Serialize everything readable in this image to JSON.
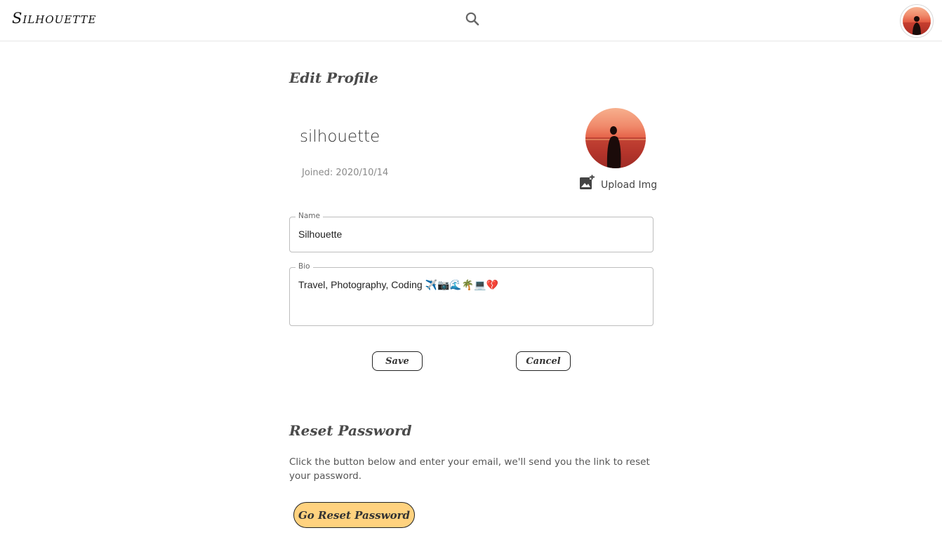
{
  "header": {
    "brand": "Silhouette",
    "search_icon": "search-icon",
    "avatar_icon": "user-avatar"
  },
  "edit_profile": {
    "title": "Edit Profile",
    "username": "silhouette",
    "joined": "Joined: 2020/10/14",
    "upload_label": "Upload Img",
    "upload_icon": "add-photo-icon",
    "name_field": {
      "label": "Name",
      "value": "Silhouette"
    },
    "bio_field": {
      "label": "Bio",
      "value": "Travel, Photography, Coding ✈️📷🌊🌴💻💔",
      "emoji_icons": [
        "airplane-icon",
        "camera-icon",
        "wave-icon",
        "palm-tree-icon",
        "laptop-icon",
        "broken-heart-icon"
      ]
    },
    "save_label": "Save",
    "cancel_label": "Cancel"
  },
  "reset_password": {
    "title": "Reset Password",
    "description": "Click the button below and enter your email, we'll send you the link to reset your password.",
    "button_label": "Go Reset Password",
    "button_color": "#ffd27f"
  }
}
